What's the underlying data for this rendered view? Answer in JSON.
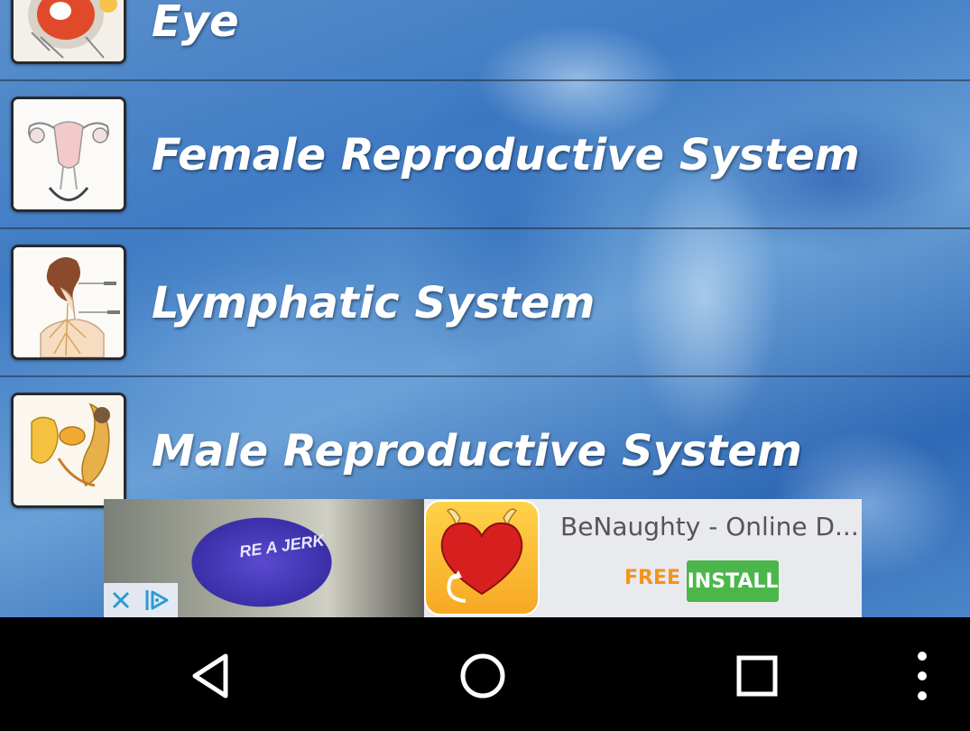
{
  "list": {
    "items": [
      {
        "label": "Eye",
        "thumb_icon": "eye-anatomy-icon"
      },
      {
        "label": "Female Reproductive System",
        "thumb_icon": "female-reproductive-anatomy-icon"
      },
      {
        "label": "Lymphatic System",
        "thumb_icon": "lymphatic-anatomy-icon"
      },
      {
        "label": "Male Reproductive System",
        "thumb_icon": "male-reproductive-anatomy-icon"
      }
    ]
  },
  "ad": {
    "photo_text": "RE A JERK",
    "title": "BeNaughty - Online D...",
    "price": "FREE",
    "install_label": "INSTALL",
    "app_icon": "heart-devil-icon",
    "close_icon": "close-icon",
    "adchoices_icon": "adchoices-icon",
    "colors": {
      "install": "#4bb74a",
      "price": "#f2941e",
      "icon_bg": "#f7a823"
    }
  },
  "navbar": {
    "back_icon": "back-triangle-icon",
    "home_icon": "home-circle-icon",
    "recents_icon": "recents-square-icon",
    "menu_icon": "overflow-menu-icon"
  }
}
